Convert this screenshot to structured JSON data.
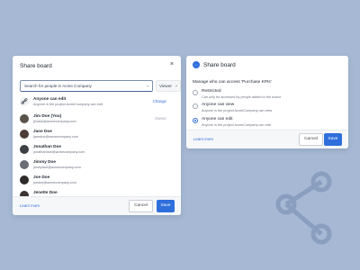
{
  "share_dialog": {
    "title": "Share board",
    "close_glyph": "×",
    "search_placeholder": "Search for people in Acme Company",
    "caret": "⌄",
    "role_select": "Viewer",
    "rows": [
      {
        "name": "Anyone can edit",
        "sub": "Anyone in the project AcmeCompany can edit",
        "action": "Change"
      },
      {
        "name": "Jim Doe (You)",
        "sub": "jimdoe@acmecompany.com",
        "action": "Owner"
      },
      {
        "name": "Jane Doe",
        "sub": "janedoe@acmecompany.com",
        "action": ""
      },
      {
        "name": "Jonathan Doe",
        "sub": "jonathandoe@acmecompany.com",
        "action": ""
      },
      {
        "name": "Jimmy Doe",
        "sub": "jimmydoe@acmecompany.com",
        "action": ""
      },
      {
        "name": "Joe Doe",
        "sub": "joedoe@acmecompany.com",
        "action": ""
      },
      {
        "name": "Jenette Doe",
        "sub": "jenettedoe@acmecompany.com",
        "action": ""
      }
    ],
    "learn_more": "Learn more",
    "cancel": "Cancel",
    "save": "Save"
  },
  "access_dialog": {
    "title": "Share board",
    "back_glyph": "←",
    "prompt": "Manage who can access 'Purchase KPIs'",
    "options": [
      {
        "title": "Restricted",
        "sub": "Can only be accessed by people added to the board",
        "selected": false
      },
      {
        "title": "Anyone can view",
        "sub": "Anyone in the project AcmeCompany can view",
        "selected": false
      },
      {
        "title": "Anyone can edit",
        "sub": "Anyone in the project AcmeCompany can edit",
        "selected": true
      }
    ],
    "learn_more": "Learn more",
    "cancel": "Cancel",
    "save": "Save"
  },
  "icons": {
    "link": "🔗",
    "share": "share-icon"
  },
  "colors": {
    "accent": "#2f6fdc",
    "background": "#a6b8d3",
    "share_art": "#8a9ec0"
  }
}
